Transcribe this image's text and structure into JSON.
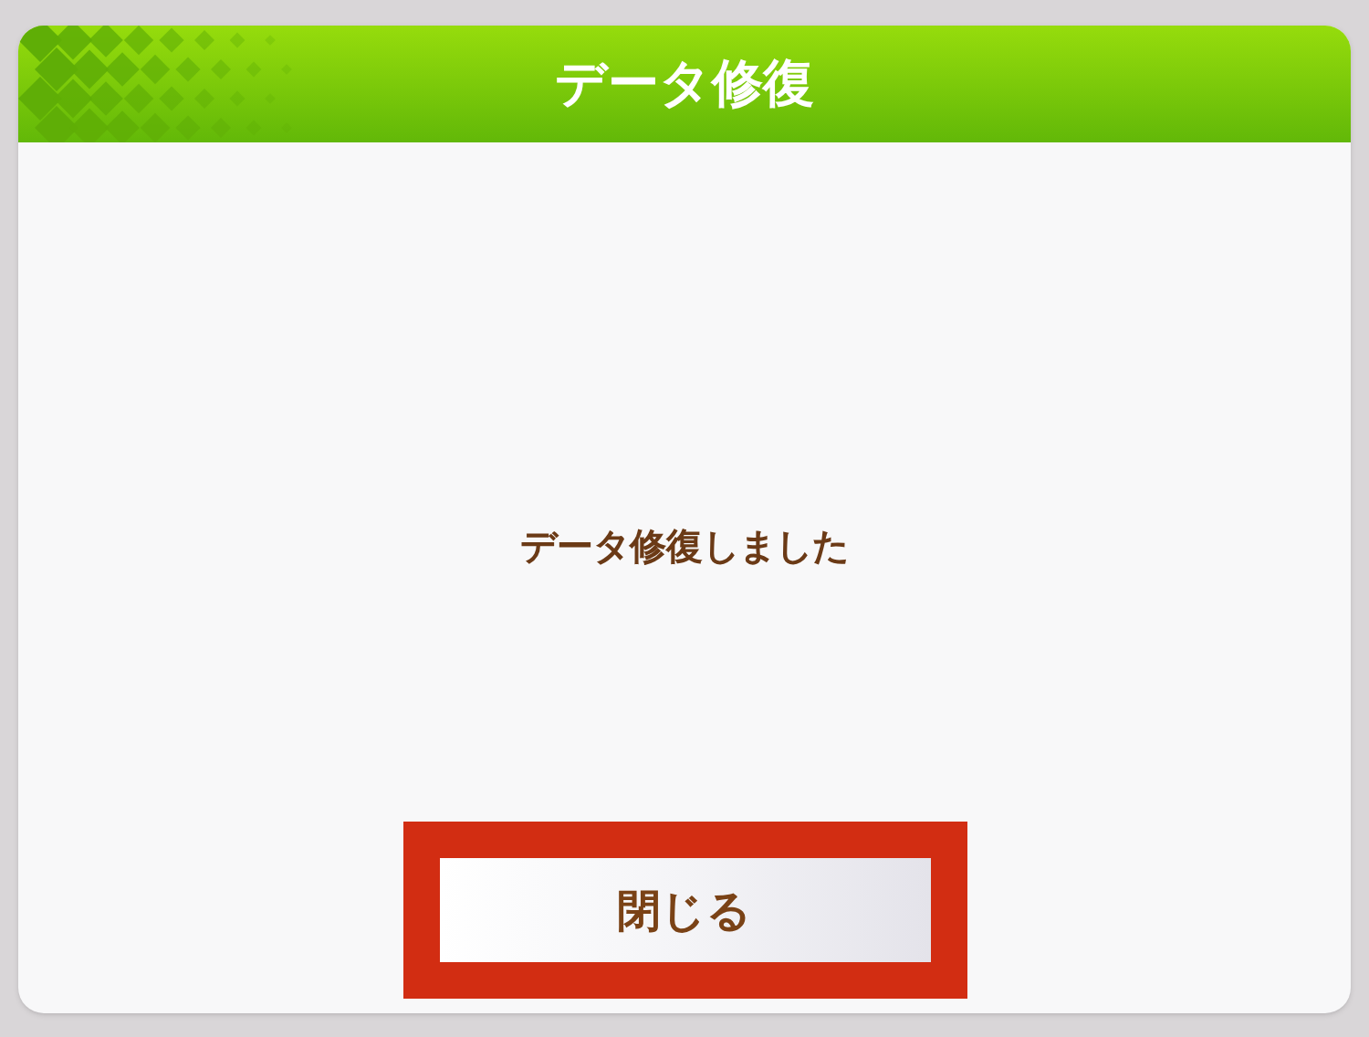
{
  "dialog": {
    "title": "データ修復",
    "message": "データ修復しました",
    "buttons": [
      {
        "label": "閉じる",
        "highlighted": true
      }
    ]
  }
}
